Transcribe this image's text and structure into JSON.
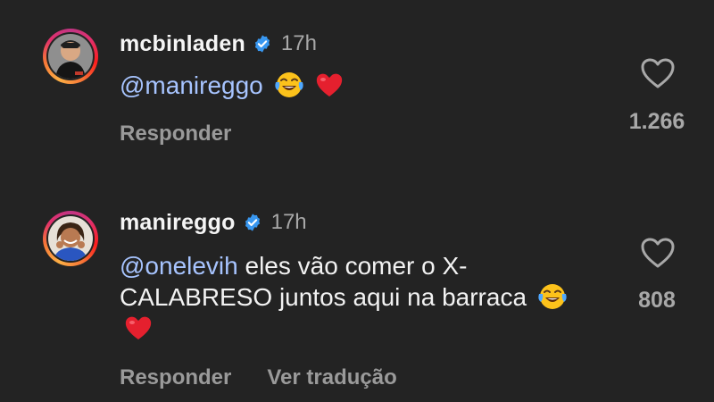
{
  "comments": [
    {
      "username": "mcbinladen",
      "time": "17h",
      "mention": "@manireggo",
      "text": "",
      "reply_label": "Responder",
      "likes": "1.266",
      "emojis": [
        "face-with-tears-of-joy",
        "red-heart"
      ]
    },
    {
      "username": "manireggo",
      "time": "17h",
      "mention": "@onelevih",
      "text": " eles vão comer o X-CALABRESO juntos aqui na barraca",
      "reply_label": "Responder",
      "translate_label": "Ver tradução",
      "likes": "808",
      "emojis": [
        "face-with-tears-of-joy",
        "red-heart"
      ]
    }
  ],
  "colors": {
    "background": "#232323",
    "mention": "#a7c4ff",
    "verified": "#3897f0",
    "secondary_text": "#a8a8a8"
  }
}
